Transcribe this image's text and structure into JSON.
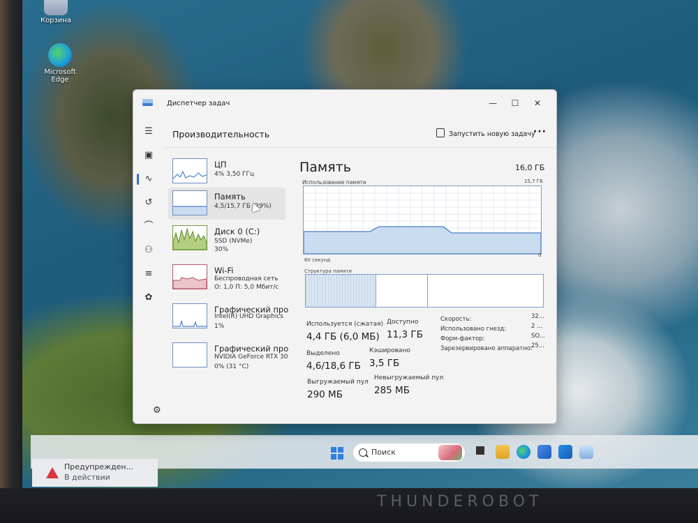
{
  "desktop": {
    "icons": [
      {
        "label": "Корзина"
      },
      {
        "label": "Microsoft Edge"
      }
    ]
  },
  "window": {
    "title": "Диспетчер задач",
    "header": "Производительность",
    "run_new_task": "Запустить новую задачу",
    "more": "···"
  },
  "nav": {
    "icons": [
      "menu-icon",
      "processes-icon",
      "performance-icon",
      "app-history-icon",
      "startup-icon",
      "users-icon",
      "details-icon",
      "services-icon",
      "settings-icon"
    ]
  },
  "perf_list": [
    {
      "title": "ЦП",
      "sub1": "4% 3,50 ГГц",
      "sub2": ""
    },
    {
      "title": "Память",
      "sub1": "4,5/15,7 ГБ (29%)",
      "sub2": ""
    },
    {
      "title": "Диск 0 (C:)",
      "sub1": "SSD (NVMe)",
      "sub2": "30%"
    },
    {
      "title": "Wi-Fi",
      "sub1": "Беспроводная сеть",
      "sub2": "О: 1,0 П: 5,0 Мбит/с"
    },
    {
      "title": "Графический про",
      "sub1": "Intel(R) UHD Graphics",
      "sub2": "1%"
    },
    {
      "title": "Графический про",
      "sub1": "NVIDIA GeForce RTX 30",
      "sub2": "0% (31 °C)"
    }
  ],
  "memory": {
    "title": "Память",
    "total": "16,0 ГБ",
    "usage_label": "Использование памяти",
    "usage_max": "15,7 ГБ",
    "axis_left": "60 секунд",
    "axis_right": "0",
    "structure_label": "Структура памяти",
    "stats": {
      "in_use_label": "Используется (сжатая)",
      "in_use_value": "4,4 ГБ (6,0 МБ)",
      "available_label": "Доступно",
      "available_value": "11,3 ГБ",
      "committed_label": "Выделено",
      "committed_value": "4,6/18,6 ГБ",
      "cached_label": "Кэшировано",
      "cached_value": "3,5 ГБ",
      "paged_label": "Выгружаемый пул",
      "paged_value": "290 МБ",
      "nonpaged_label": "Невыгружаемый пул",
      "nonpaged_value": "285 МБ"
    },
    "right_stats": [
      {
        "label": "Скорость:",
        "value": "32..."
      },
      {
        "label": "Использовано гнезд:",
        "value": "2 ..."
      },
      {
        "label": "Форм-фактор:",
        "value": "SO..."
      },
      {
        "label": "Зарезервировано аппаратно:",
        "value": "25..."
      }
    ]
  },
  "taskbar": {
    "search_placeholder": "Поиск"
  },
  "toast": {
    "title": "Предупрежден...",
    "subtitle": "В действии"
  },
  "hardware": {
    "brand": "THUNDEROBOT"
  }
}
